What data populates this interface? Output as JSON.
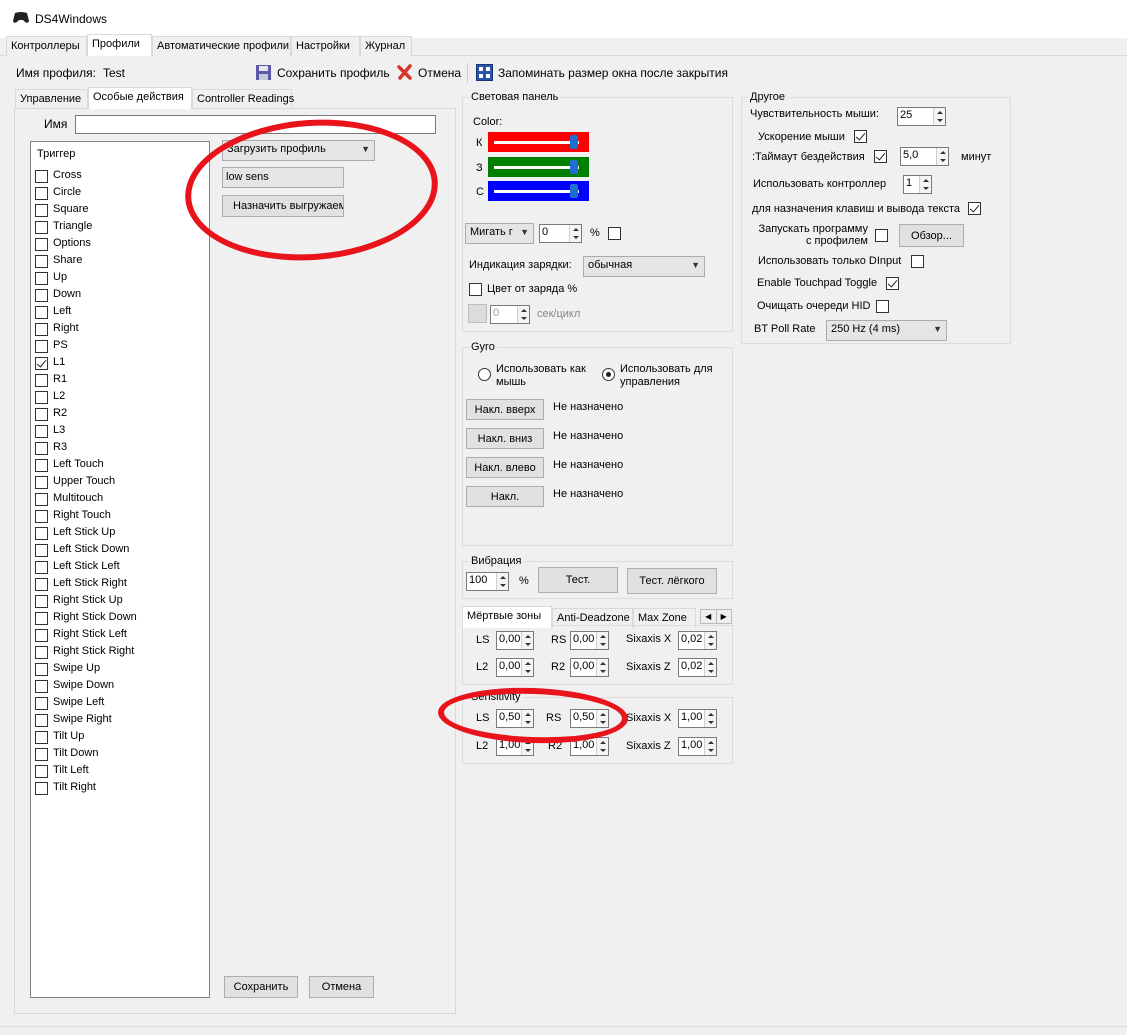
{
  "window": {
    "title": "DS4Windows"
  },
  "main_tabs": [
    "Контроллеры",
    "Профили",
    "Автоматические профили",
    "Настройки",
    "Журнал"
  ],
  "toolbar": {
    "profile_name_label": "Имя профиля:",
    "profile_name": "Test",
    "save_label": "Сохранить профиль",
    "cancel_label": "Отмена",
    "remember_label": "Запоминать размер окна после закрытия"
  },
  "sub_tabs": [
    "Управление",
    "Особые действия",
    "Controller Readings"
  ],
  "special": {
    "name_label": "Имя",
    "name_value": "",
    "trigger_header": "Триггер",
    "triggers": [
      "Cross",
      "Circle",
      "Square",
      "Triangle",
      "Options",
      "Share",
      "Up",
      "Down",
      "Left",
      "Right",
      "PS",
      "L1",
      "R1",
      "L2",
      "R2",
      "L3",
      "R3",
      "Left Touch",
      "Upper Touch",
      "Multitouch",
      "Right Touch",
      "Left Stick Up",
      "Left Stick Down",
      "Left Stick Left",
      "Left Stick Right",
      "Right Stick Up",
      "Right Stick Down",
      "Right Stick Left",
      "Right Stick Right",
      "Swipe Up",
      "Swipe Down",
      "Swipe Left",
      "Swipe Right",
      "Tilt Up",
      "Tilt Down",
      "Tilt Left",
      "Tilt Right"
    ],
    "checked_trigger": "L1",
    "action_combo": "Загрузить профиль",
    "profile_value": "low sens",
    "assign_unload": "Назначить выгружаем",
    "save_btn": "Сохранить",
    "cancel_btn": "Отмена"
  },
  "lightbar": {
    "title": "Световая панель",
    "color_label": "Color:",
    "r_label": "К",
    "g_label": "З",
    "b_label": "С",
    "r_level": 0.95,
    "g_level": 0.95,
    "b_level": 0.95,
    "r_color": "#ff0000",
    "g_color": "#008000",
    "b_color": "#0000ff",
    "flash_combo": "Мигать г",
    "flash_value": "0",
    "percent": "%",
    "charge_label": "Индикация зарядки:",
    "charge_value": "обычная",
    "charge_color_label": "Цвет от заряда %",
    "cycle_value": "0",
    "cycle_unit": "сек/цикл"
  },
  "gyro": {
    "title": "Gyro",
    "opt_mouse": "Использовать как мышь",
    "opt_controls": "Использовать для управления",
    "rows": [
      {
        "btn": "Накл. вверх",
        "value": "Не назначено"
      },
      {
        "btn": "Накл. вниз",
        "value": "Не назначено"
      },
      {
        "btn": "Накл. влево",
        "value": "Не назначено"
      },
      {
        "btn": "Накл.",
        "value": "Не назначено"
      }
    ]
  },
  "vibration": {
    "title": "Вибрация",
    "value": "100",
    "percent": "%",
    "test_btn": "Тест.",
    "test_light_btn": "Тест. лёгкого"
  },
  "deadzone": {
    "tabs": [
      "Мёртвые зоны",
      "Anti-Deadzone",
      "Max Zone"
    ],
    "ls_label": "LS",
    "ls": "0,00",
    "rs_label": "RS",
    "rs": "0,00",
    "sx_label": "Sixaxis X",
    "sx": "0,02",
    "l2_label": "L2",
    "l2": "0,00",
    "r2_label": "R2",
    "r2": "0,00",
    "sz_label": "Sixaxis Z",
    "sz": "0,02"
  },
  "sensitivity": {
    "title": "Sensitivity",
    "ls_label": "LS",
    "ls": "0,50",
    "rs_label": "RS",
    "rs": "0,50",
    "sx_label": "Sixaxis X",
    "sx": "1,00",
    "l2_label": "L2",
    "l2": "1,00",
    "r2_label": "R2",
    "r2": "1,00",
    "sz_label": "Sixaxis Z",
    "sz": "1,00"
  },
  "other": {
    "title": "Другое",
    "mouse_sens_label": "Чувствительность мыши:",
    "mouse_sens": "25",
    "mouse_accel": "Ускорение мыши",
    "idle_label": ":Таймаут бездействия",
    "idle_value": "5,0",
    "idle_unit": "минут",
    "use_controller_label": "Использовать контроллер",
    "use_controller_value": "1",
    "text_output_label": "для назначения клавиш и вывода текста",
    "launch_label_1": "Запускать программу",
    "launch_label_2": "с профилем",
    "browse_btn": "Обзор...",
    "dinput_label": "Использовать только DInput",
    "touchpad_label": "Enable Touchpad Toggle",
    "hid_label": "Очищать очереди HID",
    "bt_label": "BT Poll Rate",
    "bt_value": "250 Hz (4 ms)"
  }
}
